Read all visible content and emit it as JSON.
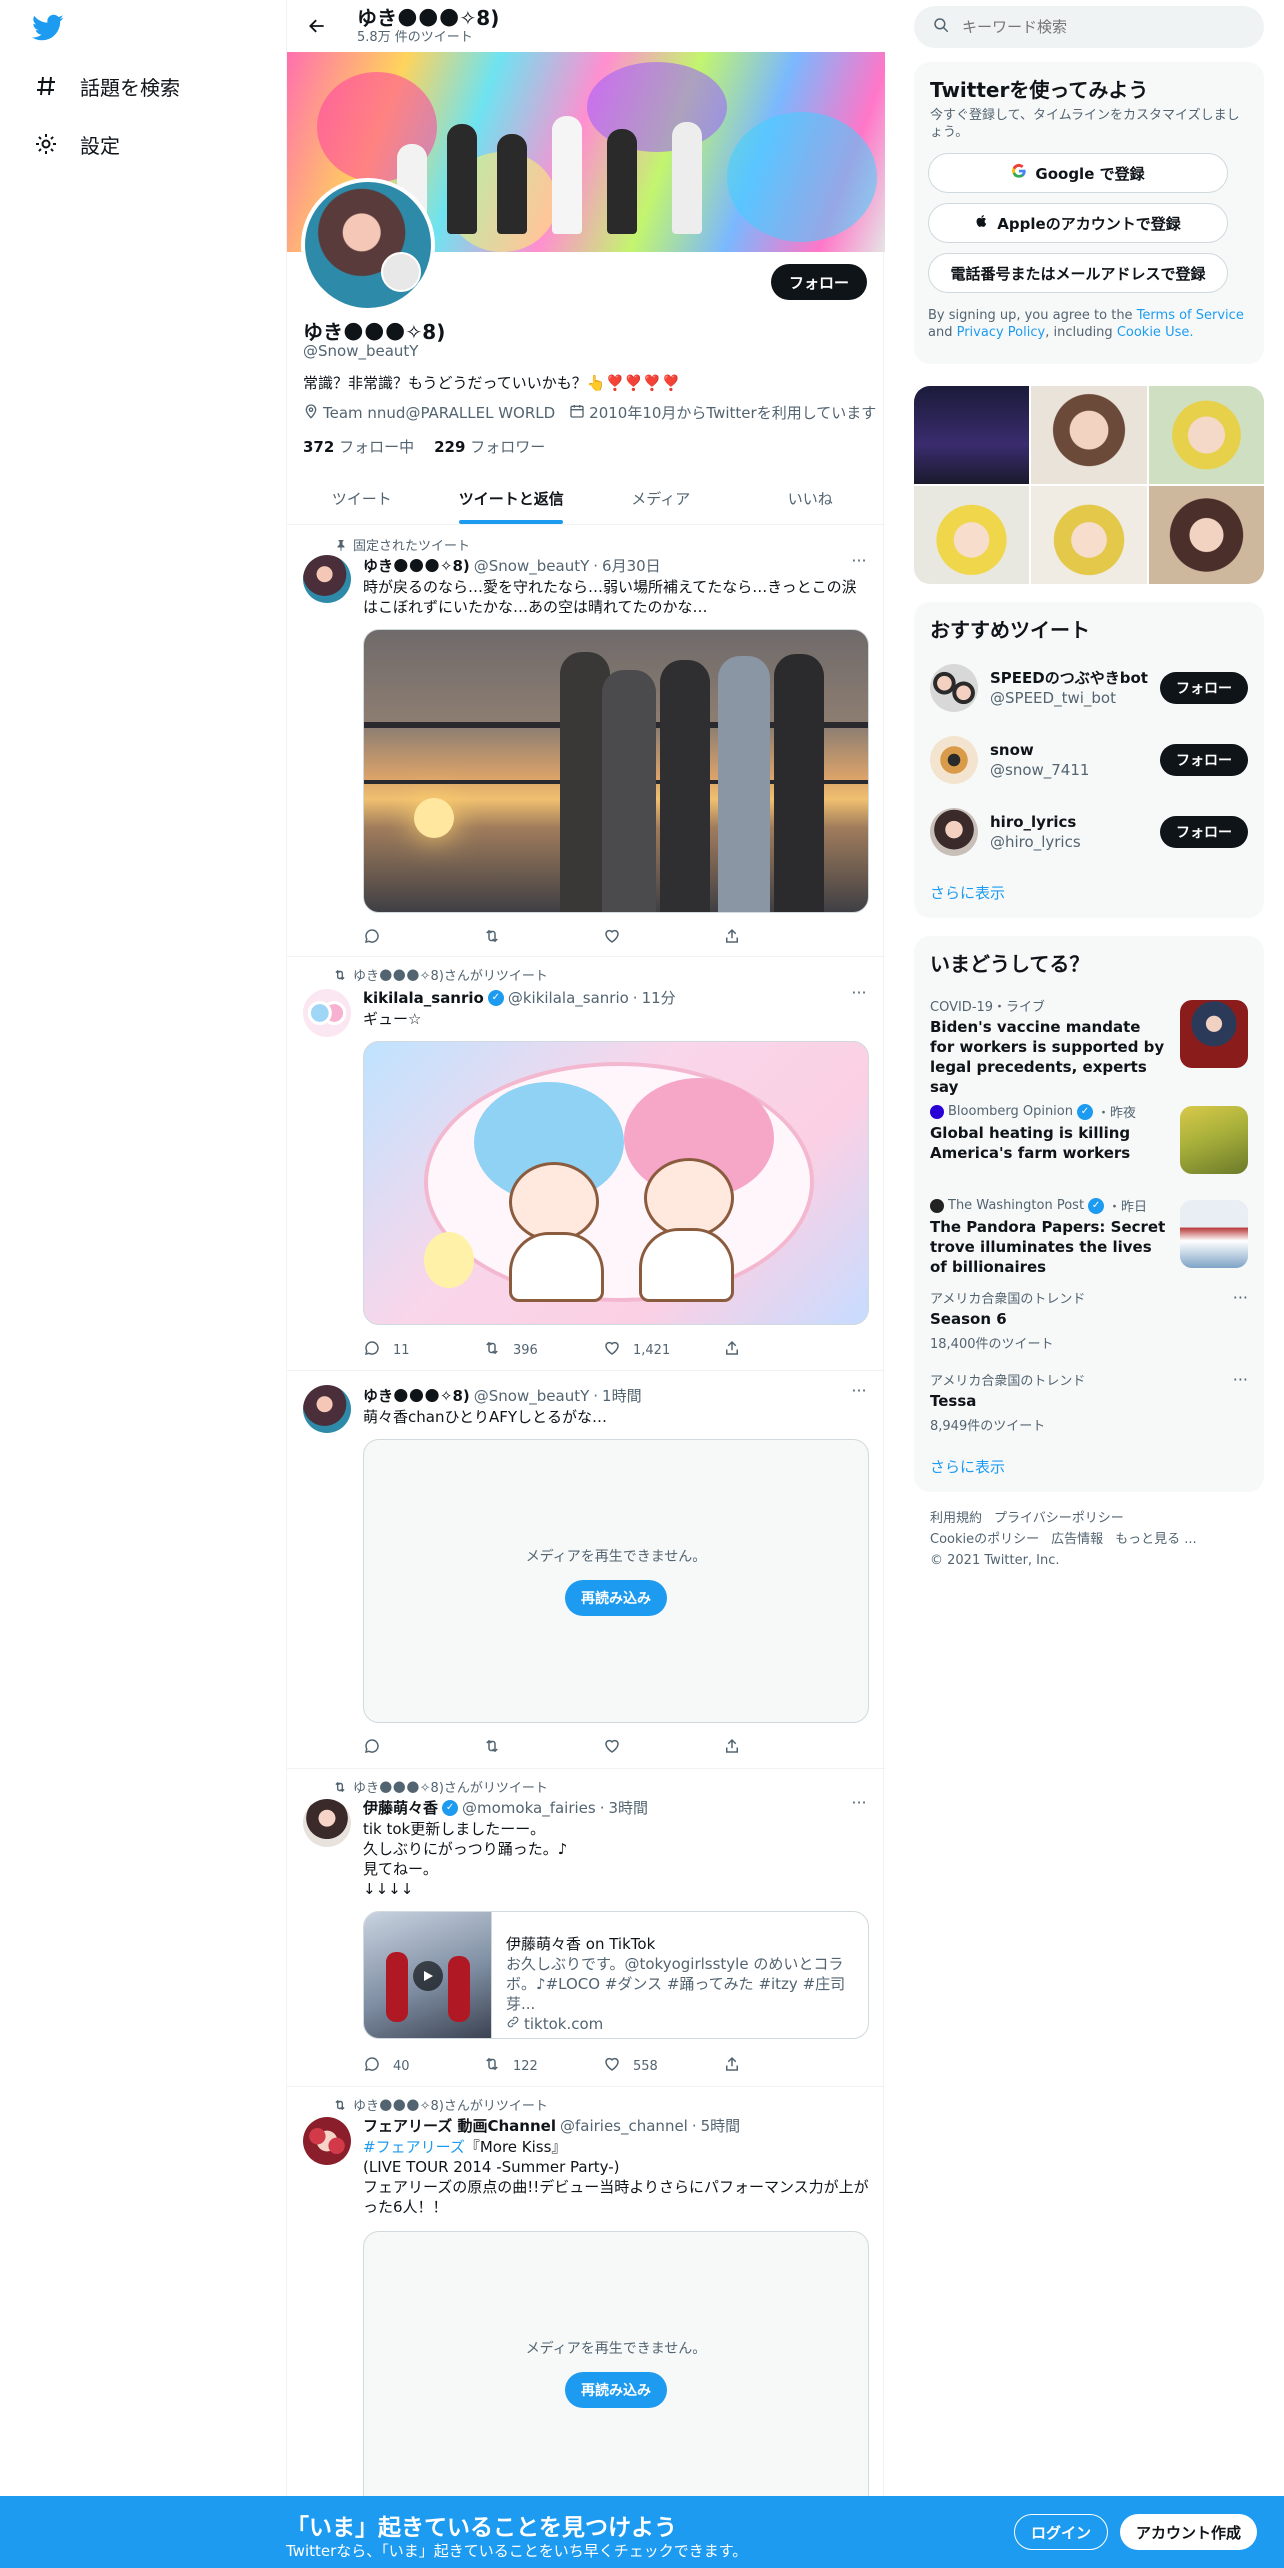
{
  "nav": {
    "explore_label": "話題を検索",
    "settings_label": "設定"
  },
  "profile": {
    "header_name": "ゆき🌑🌑🌑✧8)",
    "tweet_count": "5.8万 件のツイート",
    "name": "ゆき🌑🌑🌑✧8)",
    "handle": "@Snow_beautY",
    "bio": "常識？非常識？もうどうだっていいかも？👆❣️❣️❣️❣️",
    "location": "Team nnud@PARALLEL WORLD",
    "joined": "2010年10月からTwitterを利用しています",
    "following_count": "372",
    "following_label": "フォロー中",
    "followers_count": "229",
    "followers_label": "フォロワー",
    "follow_button": "フォロー"
  },
  "tabs": [
    "ツイート",
    "ツイートと返信",
    "メディア",
    "いいね"
  ],
  "tweets": [
    {
      "context": "固定されたツイート",
      "name": "ゆき🌑🌑🌑✧8)",
      "handle": "@Snow_beautY",
      "time": "6月30日",
      "text": "時が戻るのなら…愛を守れたなら…弱い場所補えてたなら…きっとこの涙はこぼれずにいたかな…あの空は晴れてたのかな…",
      "reply": "",
      "retweet": "",
      "like": ""
    },
    {
      "context": "ゆき🌑🌑🌑✧8)さんがリツイート",
      "name": "kikilala_sanrio",
      "handle": "@kikilala_sanrio",
      "time": "11分",
      "text": "ギュー☆",
      "reply": "11",
      "retweet": "396",
      "like": "1,421"
    },
    {
      "context": "",
      "name": "ゆき🌑🌑🌑✧8)",
      "handle": "@Snow_beautY",
      "time": "1時間",
      "text": "萌々香chanひとりAFYしとるがな…",
      "media_message": "メディアを再生できません。",
      "reload": "再読み込み",
      "reply": "",
      "retweet": "",
      "like": ""
    },
    {
      "context": "ゆき🌑🌑🌑✧8)さんがリツイート",
      "name": "伊藤萌々香",
      "handle": "@momoka_fairies",
      "time": "3時間",
      "text": "tik tok更新しましたーー。\n久しぶりにがっつり踊った。♪\n見てねー。\n↓↓↓↓",
      "card_title": "伊藤萌々香 on TikTok",
      "card_desc": "お久しぶりです。@tokyogirlsstyle のめいとコラボ。♪#LOCO #ダンス #踊ってみた #itzy #庄司芽...",
      "card_domain": "tiktok.com",
      "reply": "40",
      "retweet": "122",
      "like": "558"
    },
    {
      "context": "ゆき🌑🌑🌑✧8)さんがリツイート",
      "name": "フェアリーズ 動画Channel",
      "handle": "@fairies_channel",
      "time": "5時間",
      "hashtag": "#フェアリーズ",
      "text_rest": "『More Kiss』\n(LIVE TOUR 2014 -Summer Party-)\nフェアリーズの原点の曲!!デビュー当時よりさらにパフォーマンス力が上がった6人！！",
      "media_message": "メディアを再生できません。",
      "reload": "再読み込み"
    }
  ],
  "search": {
    "placeholder": "キーワード検索"
  },
  "signup": {
    "title": "Twitterを使ってみよう",
    "subtitle": "今すぐ登録して、タイムラインをカスタマイズしましょう。",
    "google": "Google で登録",
    "apple": "Appleのアカウントで登録",
    "phone": "電話番号またはメールアドレスで登録",
    "legal_prefix": "By signing up, you agree to the ",
    "terms": "Terms of Service",
    "and": " and ",
    "privacy": "Privacy Policy",
    "including": ", including ",
    "cookie": "Cookie Use."
  },
  "who_to_follow": {
    "title": "おすすめツイート",
    "items": [
      {
        "name": "SPEEDのつぶやきbot",
        "handle": "@SPEED_twi_bot",
        "button": "フォロー"
      },
      {
        "name": "snow",
        "handle": "@snow_7411",
        "button": "フォロー"
      },
      {
        "name": "hiro_lyrics",
        "handle": "@hiro_lyrics",
        "button": "フォロー"
      }
    ],
    "show_more": "さらに表示"
  },
  "trends": {
    "title": "いまどうしてる？",
    "items": [
      {
        "meta": "COVID-19・ライブ",
        "title": "Biden's vaccine mandate for workers is supported by legal precedents, experts say"
      },
      {
        "meta_source": "Bloomberg Opinion",
        "meta_time": "・昨夜",
        "title": "Global heating is killing America's farm workers"
      },
      {
        "meta_source": "The Washington Post",
        "meta_time": "・昨日",
        "title": "The Pandora Papers: Secret trove illuminates the lives of billionaires"
      },
      {
        "meta": "アメリカ合衆国のトレンド",
        "title": "Season 6",
        "count": "18,400件のツイート"
      },
      {
        "meta": "アメリカ合衆国のトレンド",
        "title": "Tessa",
        "count": "8,949件のツイート"
      }
    ],
    "show_more": "さらに表示"
  },
  "footer": {
    "terms": "利用規約",
    "privacy": "プライバシーポリシー",
    "cookie": "Cookieのポリシー",
    "ads": "広告情報",
    "more": "もっと見る ...",
    "copyright": "© 2021 Twitter, Inc."
  },
  "bottom_bar": {
    "title": "「いま」起きていることを見つけよう",
    "subtitle": "Twitterなら、「いま」起きていることをいち早くチェックできます。",
    "login": "ログイン",
    "signup": "アカウント作成"
  },
  "colors": {
    "accent": "#1d9bf0",
    "text": "#0f1419",
    "muted": "#536471"
  }
}
